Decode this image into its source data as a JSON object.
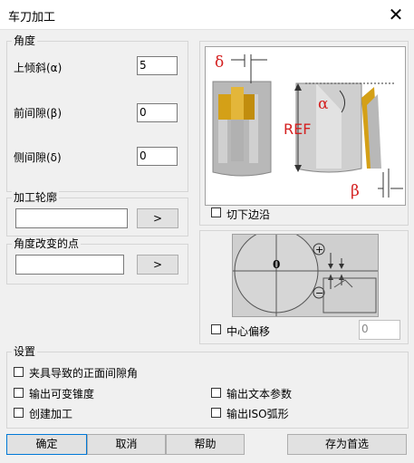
{
  "window": {
    "title": "车刀加工",
    "close_glyph": "✕"
  },
  "angle_group": {
    "title": "角度",
    "rake_label": "上倾斜(α)",
    "rake_value": "5",
    "clearance_label": "前间隙(β)",
    "clearance_value": "0",
    "side_clearance_label": "侧间隙(δ)",
    "side_clearance_value": "0"
  },
  "profile_group": {
    "title": "加工轮廓",
    "value": "",
    "button_label": ">"
  },
  "angle_change_group": {
    "title": "角度改变的点",
    "value": "",
    "button_label": ">"
  },
  "diagram1": {
    "delta": "δ",
    "alpha": "α",
    "ref": "REF",
    "beta": "β",
    "cut_edge_label": "切下边沿"
  },
  "diagram2": {
    "zero": "0",
    "plus": "+",
    "minus": "−",
    "center_offset_label": "中心偏移",
    "center_offset_value": "0"
  },
  "settings_group": {
    "title": "设置",
    "fixture_clearance_label": "夹具导致的正面间隙角",
    "variable_taper_label": "输出可变锥度",
    "text_params_label": "输出文本参数",
    "create_machining_label": "创建加工",
    "iso_arc_label": "输出ISO弧形"
  },
  "buttons": {
    "ok": "确定",
    "cancel": "取消",
    "help": "帮助",
    "save_default": "存为首选"
  },
  "colors": {
    "blade_gold": "#d4a017",
    "blade_gray": "#b0b0b0",
    "accent_red": "#d42020"
  }
}
